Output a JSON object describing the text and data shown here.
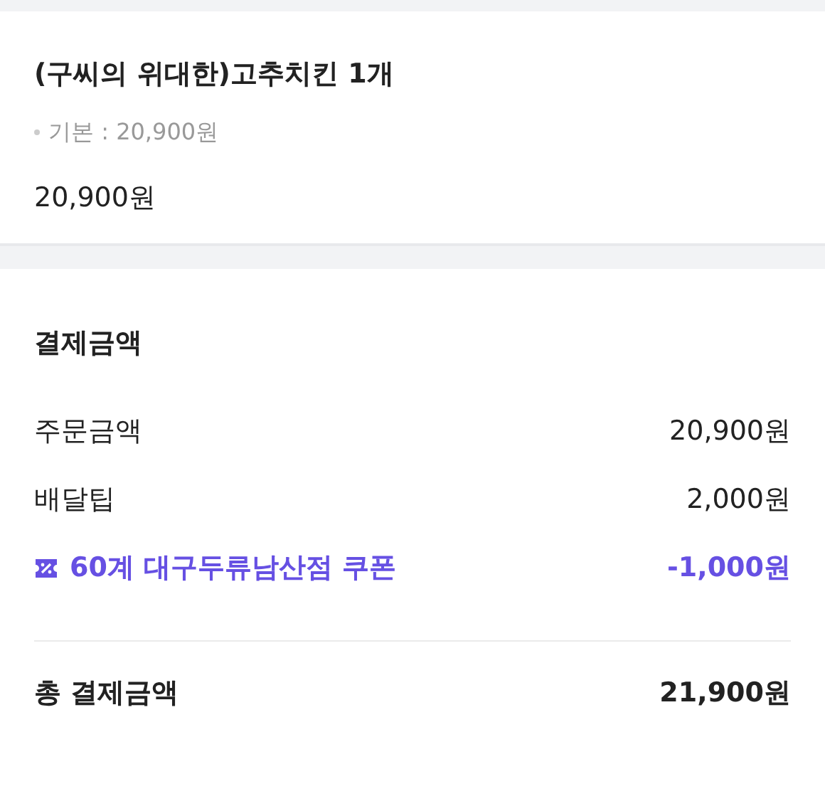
{
  "order_item": {
    "name": "(구씨의 위대한)고추치킨 1개",
    "option": "기본 : 20,900원",
    "price": "20,900원"
  },
  "payment": {
    "title": "결제금액",
    "rows": [
      {
        "kind": "normal",
        "label": "주문금액",
        "amount": "20,900원"
      },
      {
        "kind": "normal",
        "label": "배달팁",
        "amount": "2,000원"
      },
      {
        "kind": "discount",
        "label": "60계 대구두류남산점 쿠폰",
        "amount": "-1,000원"
      }
    ],
    "total": {
      "label": "총 결제금액",
      "amount": "21,900원"
    }
  }
}
